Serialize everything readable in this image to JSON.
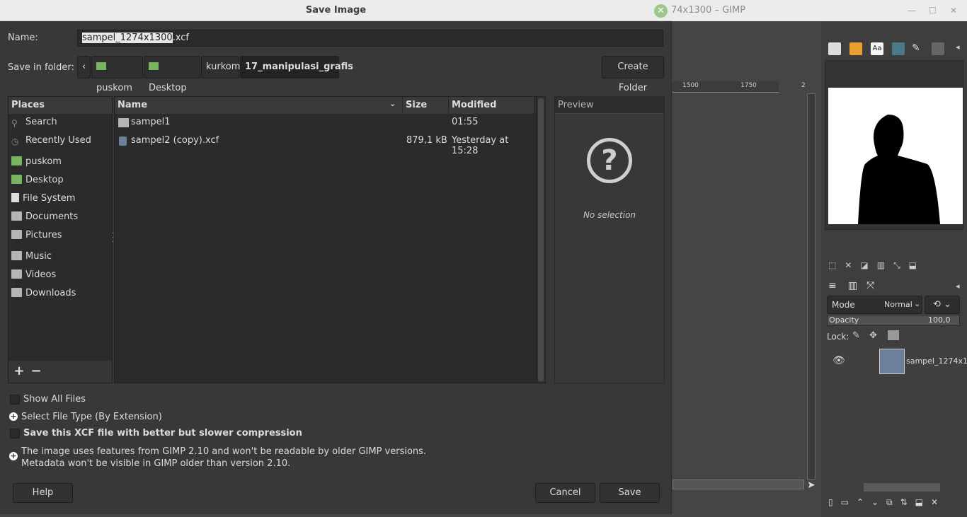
{
  "gimp_window": {
    "title": "74x1300 – GIMP",
    "ruler_ticks": [
      "1500",
      "1750",
      "2"
    ],
    "mode_label": "Mode",
    "mode_value": "Normal",
    "opacity_label": "Opacity",
    "opacity_value": "100,0",
    "lock_label": "Lock:",
    "layer_name": "sampel_1274x1"
  },
  "dialog": {
    "title": "Save Image",
    "name_label": "Name:",
    "name_selected": "sampel_1274x1300",
    "name_ext": ".xcf",
    "save_in_label": "Save in folder:",
    "breadcrumbs": [
      "puskom",
      "Desktop",
      "kurkom",
      "17_manipulasi_grafis"
    ],
    "create_folder": "Create Folder",
    "places_header": "Places",
    "places": [
      "Search",
      "Recently Used",
      "puskom",
      "Desktop",
      "File System",
      "Documents",
      "Pictures",
      "Music",
      "Videos",
      "Downloads"
    ],
    "columns": {
      "name": "Name",
      "size": "Size",
      "modified": "Modified"
    },
    "files": [
      {
        "name": "sampel1",
        "size": "",
        "modified": "01:55",
        "type": "folder"
      },
      {
        "name": "sampel2 (copy).xcf",
        "size": "879,1 kB",
        "modified": "Yesterday at 15:28",
        "type": "xcf"
      }
    ],
    "preview_header": "Preview",
    "no_selection": "No selection",
    "show_all_files": "Show All Files",
    "select_file_type": "Select File Type (By Extension)",
    "compression": "Save this XCF file with better but slower compression",
    "compat_line1": "The image uses features from GIMP 2.10 and won't be readable by older GIMP versions.",
    "compat_line2": "Metadata won't be visible in GIMP older than version 2.10.",
    "help": "Help",
    "cancel": "Cancel",
    "save": "Save"
  }
}
